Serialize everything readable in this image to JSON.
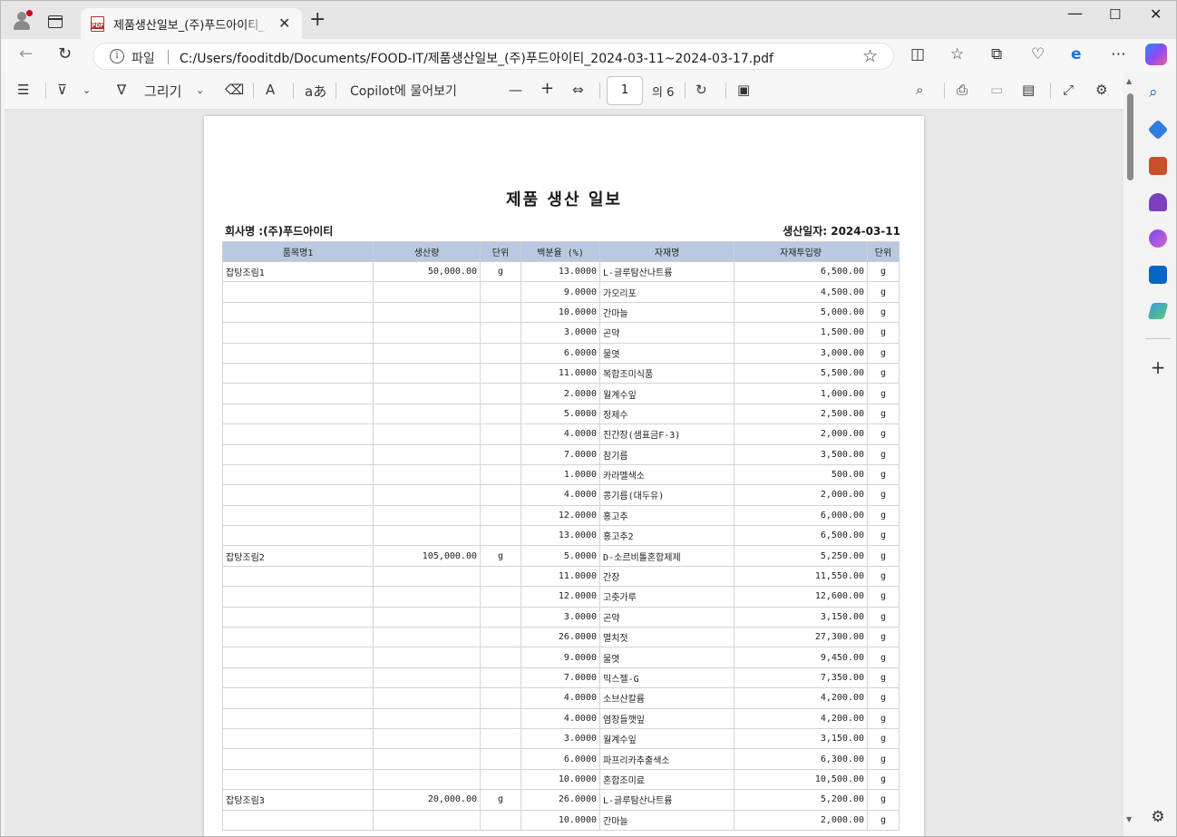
{
  "browser": {
    "tab_title": "제품생산일보_(주)푸드아이티_2024-03-11~2024-03-17.pdf",
    "tab_close": "✕",
    "new_tab": "+",
    "address_label": "파일",
    "url": "C:/Users/fooditdb/Documents/FOOD-IT/제품생산일보_(주)푸드아이티_2024-03-11~2024-03-17.pdf"
  },
  "pdf_toolbar": {
    "draw_label": "그리기",
    "copilot_label": "Copilot에 물어보기",
    "page_number": "1",
    "page_total": "의 6"
  },
  "report": {
    "title": "제품 생산 일보",
    "company": "회사명 :(주)푸드아이티",
    "production_date": "생산일자: 2024-03-11",
    "columns": [
      "품목명1",
      "생산량",
      "단위",
      "백분율 (%)",
      "자재명",
      "자재투입량",
      "단위"
    ],
    "rows": [
      [
        "잡탕조림1",
        "50,000.00",
        "g",
        "13.0000",
        "L-글루탐산나트륨",
        "6,500.00",
        "g"
      ],
      [
        "",
        "",
        "",
        "9.0000",
        "가오리포",
        "4,500.00",
        "g"
      ],
      [
        "",
        "",
        "",
        "10.0000",
        "간마늘",
        "5,000.00",
        "g"
      ],
      [
        "",
        "",
        "",
        "3.0000",
        "곤약",
        "1,500.00",
        "g"
      ],
      [
        "",
        "",
        "",
        "6.0000",
        "물엿",
        "3,000.00",
        "g"
      ],
      [
        "",
        "",
        "",
        "11.0000",
        "복합조미식품",
        "5,500.00",
        "g"
      ],
      [
        "",
        "",
        "",
        "2.0000",
        "월계수잎",
        "1,000.00",
        "g"
      ],
      [
        "",
        "",
        "",
        "5.0000",
        "정제수",
        "2,500.00",
        "g"
      ],
      [
        "",
        "",
        "",
        "4.0000",
        "진간장(샘표금F-3)",
        "2,000.00",
        "g"
      ],
      [
        "",
        "",
        "",
        "7.0000",
        "참기름",
        "3,500.00",
        "g"
      ],
      [
        "",
        "",
        "",
        "1.0000",
        "카라멜색소",
        "500.00",
        "g"
      ],
      [
        "",
        "",
        "",
        "4.0000",
        "콩기름(대두유)",
        "2,000.00",
        "g"
      ],
      [
        "",
        "",
        "",
        "12.0000",
        "홍고추",
        "6,000.00",
        "g"
      ],
      [
        "",
        "",
        "",
        "13.0000",
        "홍고추2",
        "6,500.00",
        "g"
      ],
      [
        "잡탕조림2",
        "105,000.00",
        "g",
        "5.0000",
        "D-소르비톨혼합제제",
        "5,250.00",
        "g"
      ],
      [
        "",
        "",
        "",
        "11.0000",
        "간장",
        "11,550.00",
        "g"
      ],
      [
        "",
        "",
        "",
        "12.0000",
        "고춧가루",
        "12,600.00",
        "g"
      ],
      [
        "",
        "",
        "",
        "3.0000",
        "곤약",
        "3,150.00",
        "g"
      ],
      [
        "",
        "",
        "",
        "26.0000",
        "멸치젓",
        "27,300.00",
        "g"
      ],
      [
        "",
        "",
        "",
        "9.0000",
        "물엿",
        "9,450.00",
        "g"
      ],
      [
        "",
        "",
        "",
        "7.0000",
        "믹스젤-G",
        "7,350.00",
        "g"
      ],
      [
        "",
        "",
        "",
        "4.0000",
        "소브산칼륨",
        "4,200.00",
        "g"
      ],
      [
        "",
        "",
        "",
        "4.0000",
        "염장들깻잎",
        "4,200.00",
        "g"
      ],
      [
        "",
        "",
        "",
        "3.0000",
        "월계수잎",
        "3,150.00",
        "g"
      ],
      [
        "",
        "",
        "",
        "6.0000",
        "파프리카추출색소",
        "6,300.00",
        "g"
      ],
      [
        "",
        "",
        "",
        "10.0000",
        "혼합조미료",
        "10,500.00",
        "g"
      ],
      [
        "잡탕조림3",
        "20,000.00",
        "g",
        "26.0000",
        "L-글루탐산나트륨",
        "5,200.00",
        "g"
      ],
      [
        "",
        "",
        "",
        "10.0000",
        "간마늘",
        "2,000.00",
        "g"
      ]
    ]
  }
}
